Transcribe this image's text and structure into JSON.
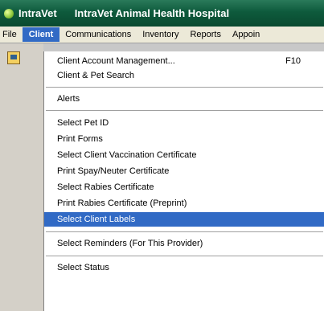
{
  "title": {
    "app_name": "IntraVet",
    "window_title": "IntraVet Animal Health Hospital"
  },
  "menubar": {
    "items": [
      "File",
      "Client",
      "Communications",
      "Inventory",
      "Reports",
      "Appoin"
    ],
    "active": "Client"
  },
  "toolbar": {
    "icon": "open-folder-icon"
  },
  "client_menu": {
    "items": [
      {
        "label": "Client Account Management...",
        "shortcut": "F10"
      },
      {
        "label": "Client & Pet Search",
        "shortcut": ""
      },
      {
        "label": "Alerts",
        "shortcut": ""
      },
      {
        "label": "Select Pet ID",
        "shortcut": ""
      },
      {
        "label": "Print Forms",
        "shortcut": ""
      },
      {
        "label": "Select Client Vaccination Certificate",
        "shortcut": ""
      },
      {
        "label": "Print Spay/Neuter Certificate",
        "shortcut": ""
      },
      {
        "label": "Select Rabies Certificate",
        "shortcut": ""
      },
      {
        "label": "Print Rabies Certificate (Preprint)",
        "shortcut": ""
      },
      {
        "label": "Select Client Labels",
        "shortcut": ""
      },
      {
        "label": "Select Reminders (For This Provider)",
        "shortcut": ""
      },
      {
        "label": "Select Status",
        "shortcut": ""
      }
    ],
    "highlighted_index": 9
  },
  "colors": {
    "title_bar": "#0e5a3c",
    "highlight": "#316ac5",
    "menu_bg": "#ffffff"
  }
}
